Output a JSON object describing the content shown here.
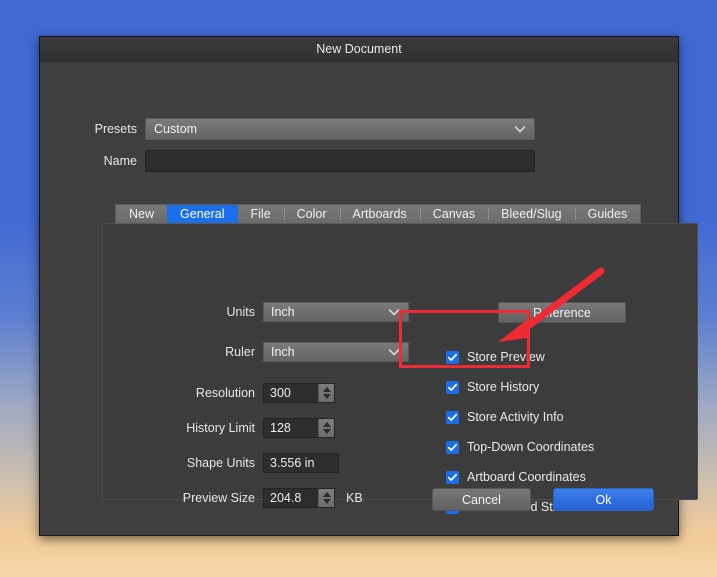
{
  "window": {
    "title": "New Document"
  },
  "top_fields": {
    "presets": {
      "label": "Presets",
      "value": "Custom",
      "chevron_icon": "chevron-down-icon"
    },
    "name": {
      "label": "Name",
      "value": "",
      "placeholder": ""
    }
  },
  "tabs": [
    {
      "label": "New",
      "active": false
    },
    {
      "label": "General",
      "active": true
    },
    {
      "label": "File",
      "active": false
    },
    {
      "label": "Color",
      "active": false
    },
    {
      "label": "Artboards",
      "active": false
    },
    {
      "label": "Canvas",
      "active": false
    },
    {
      "label": "Bleed/Slug",
      "active": false
    },
    {
      "label": "Guides",
      "active": false
    }
  ],
  "general_panel": {
    "units": {
      "label": "Units",
      "value": "Inch"
    },
    "ruler": {
      "label": "Ruler",
      "value": "Inch"
    },
    "resolution": {
      "label": "Resolution",
      "value": "300"
    },
    "history_limit": {
      "label": "History Limit",
      "value": "128"
    },
    "shape_units": {
      "label": "Shape Units",
      "value": "3.556 in"
    },
    "preview_size": {
      "label": "Preview Size",
      "value": "204.8",
      "unit": "KB"
    },
    "reference_button": "Reference",
    "checkboxes": [
      {
        "label": "Store Preview",
        "checked": true
      },
      {
        "label": "Store History",
        "checked": true
      },
      {
        "label": "Store Activity Info",
        "checked": true
      },
      {
        "label": "Top-Down Coordinates",
        "checked": true
      },
      {
        "label": "Artboard Coordinates",
        "checked": true
      },
      {
        "label": "Transformed Stroke",
        "checked": true
      }
    ]
  },
  "footer": {
    "cancel_label": "Cancel",
    "ok_label": "Ok"
  },
  "annotations": {
    "highlight_color": "#ee2b34",
    "box_target": "Store History and Store Activity Info checkboxes",
    "arrow_icon": "arrow-pointing-down-left-icon"
  },
  "colors": {
    "accent_blue": "#1a6fe8",
    "dialog_background": "#3f3f3f",
    "panel_background": "#3c3c3c",
    "annotation_red": "#ee2b34"
  }
}
